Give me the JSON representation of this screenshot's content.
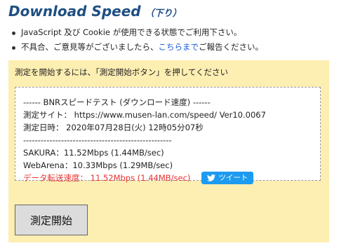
{
  "header": {
    "title": "Download Speed",
    "subtitle": "（下り）"
  },
  "notes": {
    "item1": "JavaScript 及び Cookie が使用できる状態でご利用下さい。",
    "item2_before": "不具合、ご意見等がございましたら、",
    "item2_link": "こちらまで",
    "item2_after": "ご報告ください。"
  },
  "panel": {
    "instruction": "測定を開始するには、「測定開始ボタン」を押してください",
    "result": {
      "line1": "------ BNRスピードテスト (ダウンロード速度) ------",
      "line2": "測定サイト： https://www.musen-lan.com/speed/ Ver10.0067",
      "line3": "測定日時： 2020年07月28日(火) 12時05分07秒",
      "line4": "---------------------------------------------------",
      "line5": "SAKURA：11.52Mbps (1.44MB/sec)",
      "line6": "WebArena：10.33Mbps (1.29MB/sec)",
      "line7": "データ転送速度： 11.52Mbps (1.44MB/sec)"
    },
    "tweet_label": "ツイート",
    "start_button": "測定開始"
  },
  "colors": {
    "title": "#1f4f82",
    "panel_bg": "#fdeeb2",
    "link": "#1a5bd6",
    "highlight": "#e8322f",
    "tweet": "#1d9bf0"
  }
}
